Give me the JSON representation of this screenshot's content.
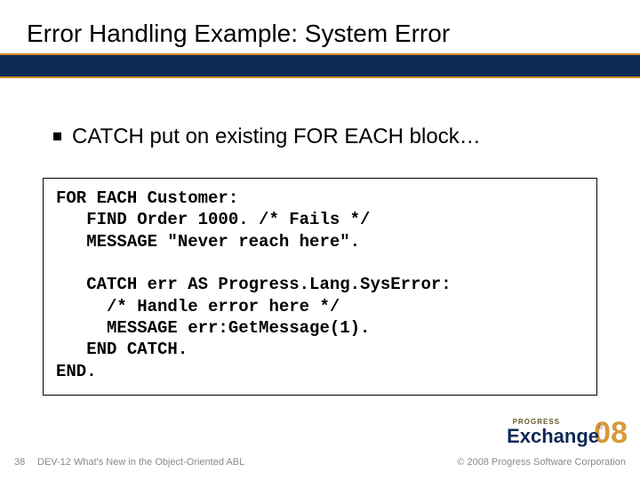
{
  "title": "Error Handling Example: System Error",
  "bullet": "CATCH put on existing FOR EACH block…",
  "code": "FOR EACH Customer:\n   FIND Order 1000. /* Fails */\n   MESSAGE \"Never reach here\".\n\n   CATCH err AS Progress.Lang.SysError:\n     /* Handle error here */\n     MESSAGE err:GetMessage(1).\n   END CATCH.\nEND.",
  "footer": {
    "slide_number": "38",
    "left": "DEV-12 What's New in the Object-Oriented ABL",
    "right": "© 2008 Progress Software Corporation"
  },
  "logo": {
    "brand": "PROGRESS",
    "event": "Exchange",
    "year": "08",
    "reg": "®"
  }
}
